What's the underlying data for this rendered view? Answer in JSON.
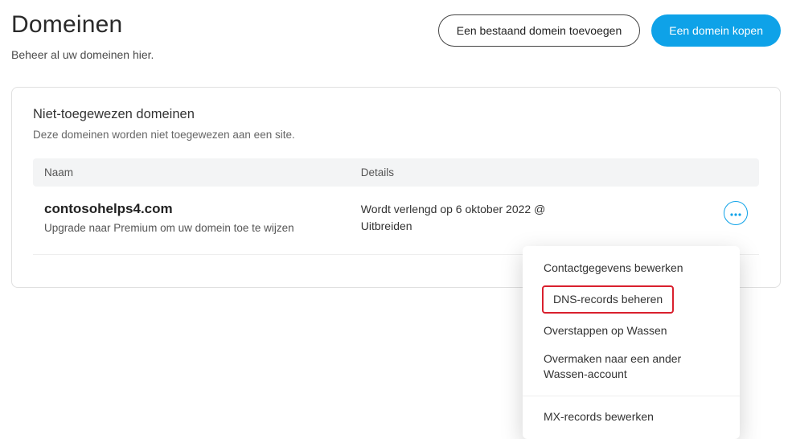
{
  "header": {
    "title": "Domeinen",
    "subtitle": "Beheer al uw domeinen hier.",
    "add_existing_label": "Een bestaand domein toevoegen",
    "buy_label": "Een domein kopen"
  },
  "card": {
    "title": "Niet-toegewezen domeinen",
    "subtitle": "Deze domeinen worden niet toegewezen aan een site."
  },
  "table": {
    "col_name": "Naam",
    "col_details": "Details"
  },
  "row": {
    "domain": "contosohelps4.com",
    "upgrade_note": "Upgrade naar Premium om uw domein toe te wijzen",
    "details_line1": "Wordt verlengd op 6 oktober 2022 @",
    "details_line2": "Uitbreiden"
  },
  "menu": {
    "edit_contacts": "Contactgegevens bewerken",
    "manage_dns": "DNS-records beheren",
    "switch": "Overstappen op Wassen",
    "transfer": "Overmaken naar een ander Wassen-account",
    "mx": "MX-records bewerken"
  },
  "colors": {
    "primary": "#0ea2e8",
    "highlight_border": "#d9202e"
  }
}
